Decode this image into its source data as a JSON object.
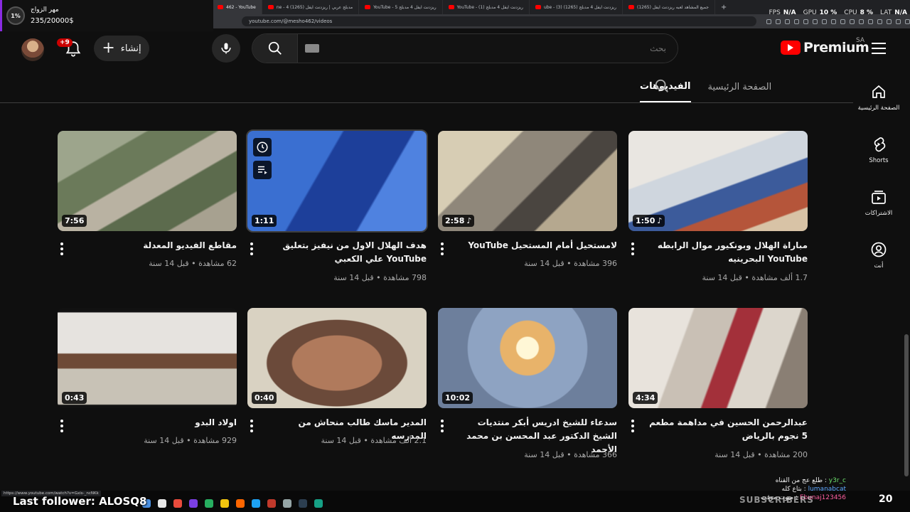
{
  "browser": {
    "tabs": [
      {
        "label": "462 - YouTube",
        "active": true
      },
      {
        "label": "ne - 4 مدبلج عربي | ريزدنت ايفل (1265)"
      },
      {
        "label": "YouTube - 5 ريزدنت ايفل 4 مدبلج"
      },
      {
        "label": "YouTube - (1) ريزدنت ايفل 4 مدبلج"
      },
      {
        "label": "ube - (3) ريزدنت ايفل 4 مدبلج (1265)"
      },
      {
        "label": "(1265) جميع المشاهد لعبه ريزدنت ايفل"
      }
    ],
    "new_tab": "+",
    "url": "youtube.com/@mesho462/videos",
    "status_url": "https://www.youtube.com/watch?v=Gxis-_ncNKk"
  },
  "stats": {
    "fps_label": "FPS",
    "fps_value": "N/A",
    "gpu_label": "GPU",
    "gpu_value": "10 %",
    "cpu_label": "CPU",
    "cpu_value": "8 %",
    "lat_label": "LAT",
    "lat_value": "N/A"
  },
  "goal_overlay": {
    "percent": "1%",
    "title": "مهر الزواج",
    "amount": "235/20000$",
    "accent": "#8a2be2"
  },
  "header": {
    "notifications_badge": "+9",
    "create_label": "إنشاء",
    "search_placeholder": "بحث",
    "logo_word": "Premium",
    "country_code": "SA",
    "brand_color": "#ff0000"
  },
  "channel_tabs": [
    {
      "label": "الصفحة الرئيسية",
      "active": false
    },
    {
      "label": "الفيديوهات",
      "active": true
    }
  ],
  "right_nav": [
    {
      "label": "الصفحة الرئيسية",
      "icon": "home-icon"
    },
    {
      "label": "Shorts",
      "icon": "shorts-icon"
    },
    {
      "label": "الاشتراكات",
      "icon": "subscriptions-icon"
    },
    {
      "label": "أنت",
      "icon": "you-icon"
    }
  ],
  "videos": [
    {
      "title": "مباراة الهلال وبونكيور موال الرابطه YouTube البحرينيه",
      "views": "1.7 ألف مشاهدة",
      "age": "قبل 14 سنة",
      "duration": "1:50",
      "music": true
    },
    {
      "title": "لامستحيل أمام المستحيل YouTube",
      "views": "396 مشاهدة",
      "age": "قبل 14 سنة",
      "duration": "2:58",
      "music": true
    },
    {
      "title": "هدف الهلال الاول من نيفيز بتعليق YouTube علي الكعبي",
      "views": "798 مشاهدة",
      "age": "قبل 14 سنة",
      "duration": "1:11",
      "music": false
    },
    {
      "title": "مقاطع الفيديو المعدلة",
      "views": "62 مشاهدة",
      "age": "قبل 14 سنة",
      "duration": "7:56",
      "music": false
    },
    {
      "title": "عبدالرحمن الحسين في مداهمة مطعم 5 نجوم بالرياض",
      "views": "200 مشاهدة",
      "age": "قبل 14 سنة",
      "duration": "4:34",
      "music": false
    },
    {
      "title": "سدعاء للشيخ ادريس أبكر منتديات الشيخ الدكتور عبد المحسن بن محمد الأحمد",
      "views": "366 مشاهدة",
      "age": "قبل 14 سنة",
      "duration": "10:02",
      "music": false
    },
    {
      "title": "المدير ماسك طالب منحاش من المدرسه",
      "views": "2.1 ألف مشاهدة",
      "age": "قبل 14 سنة",
      "duration": "0:40",
      "music": false
    },
    {
      "title": "اولاد البدو",
      "views": "929 مشاهدة",
      "age": "قبل 14 سنة",
      "duration": "0:43",
      "music": false
    }
  ],
  "stream_overlay": {
    "last_follower": "Last follower: ALOSQ8",
    "subscribers_label": "SUBSCRIBERS",
    "subscribers_count": "20",
    "chat": [
      {
        "user": "y3r_c",
        "text": "طلع عج من القناه"
      },
      {
        "user": "lumanabcat",
        "text": "بتاع كله"
      },
      {
        "user": "Ebunaj123456",
        "text": "ميوت موقت"
      }
    ]
  }
}
